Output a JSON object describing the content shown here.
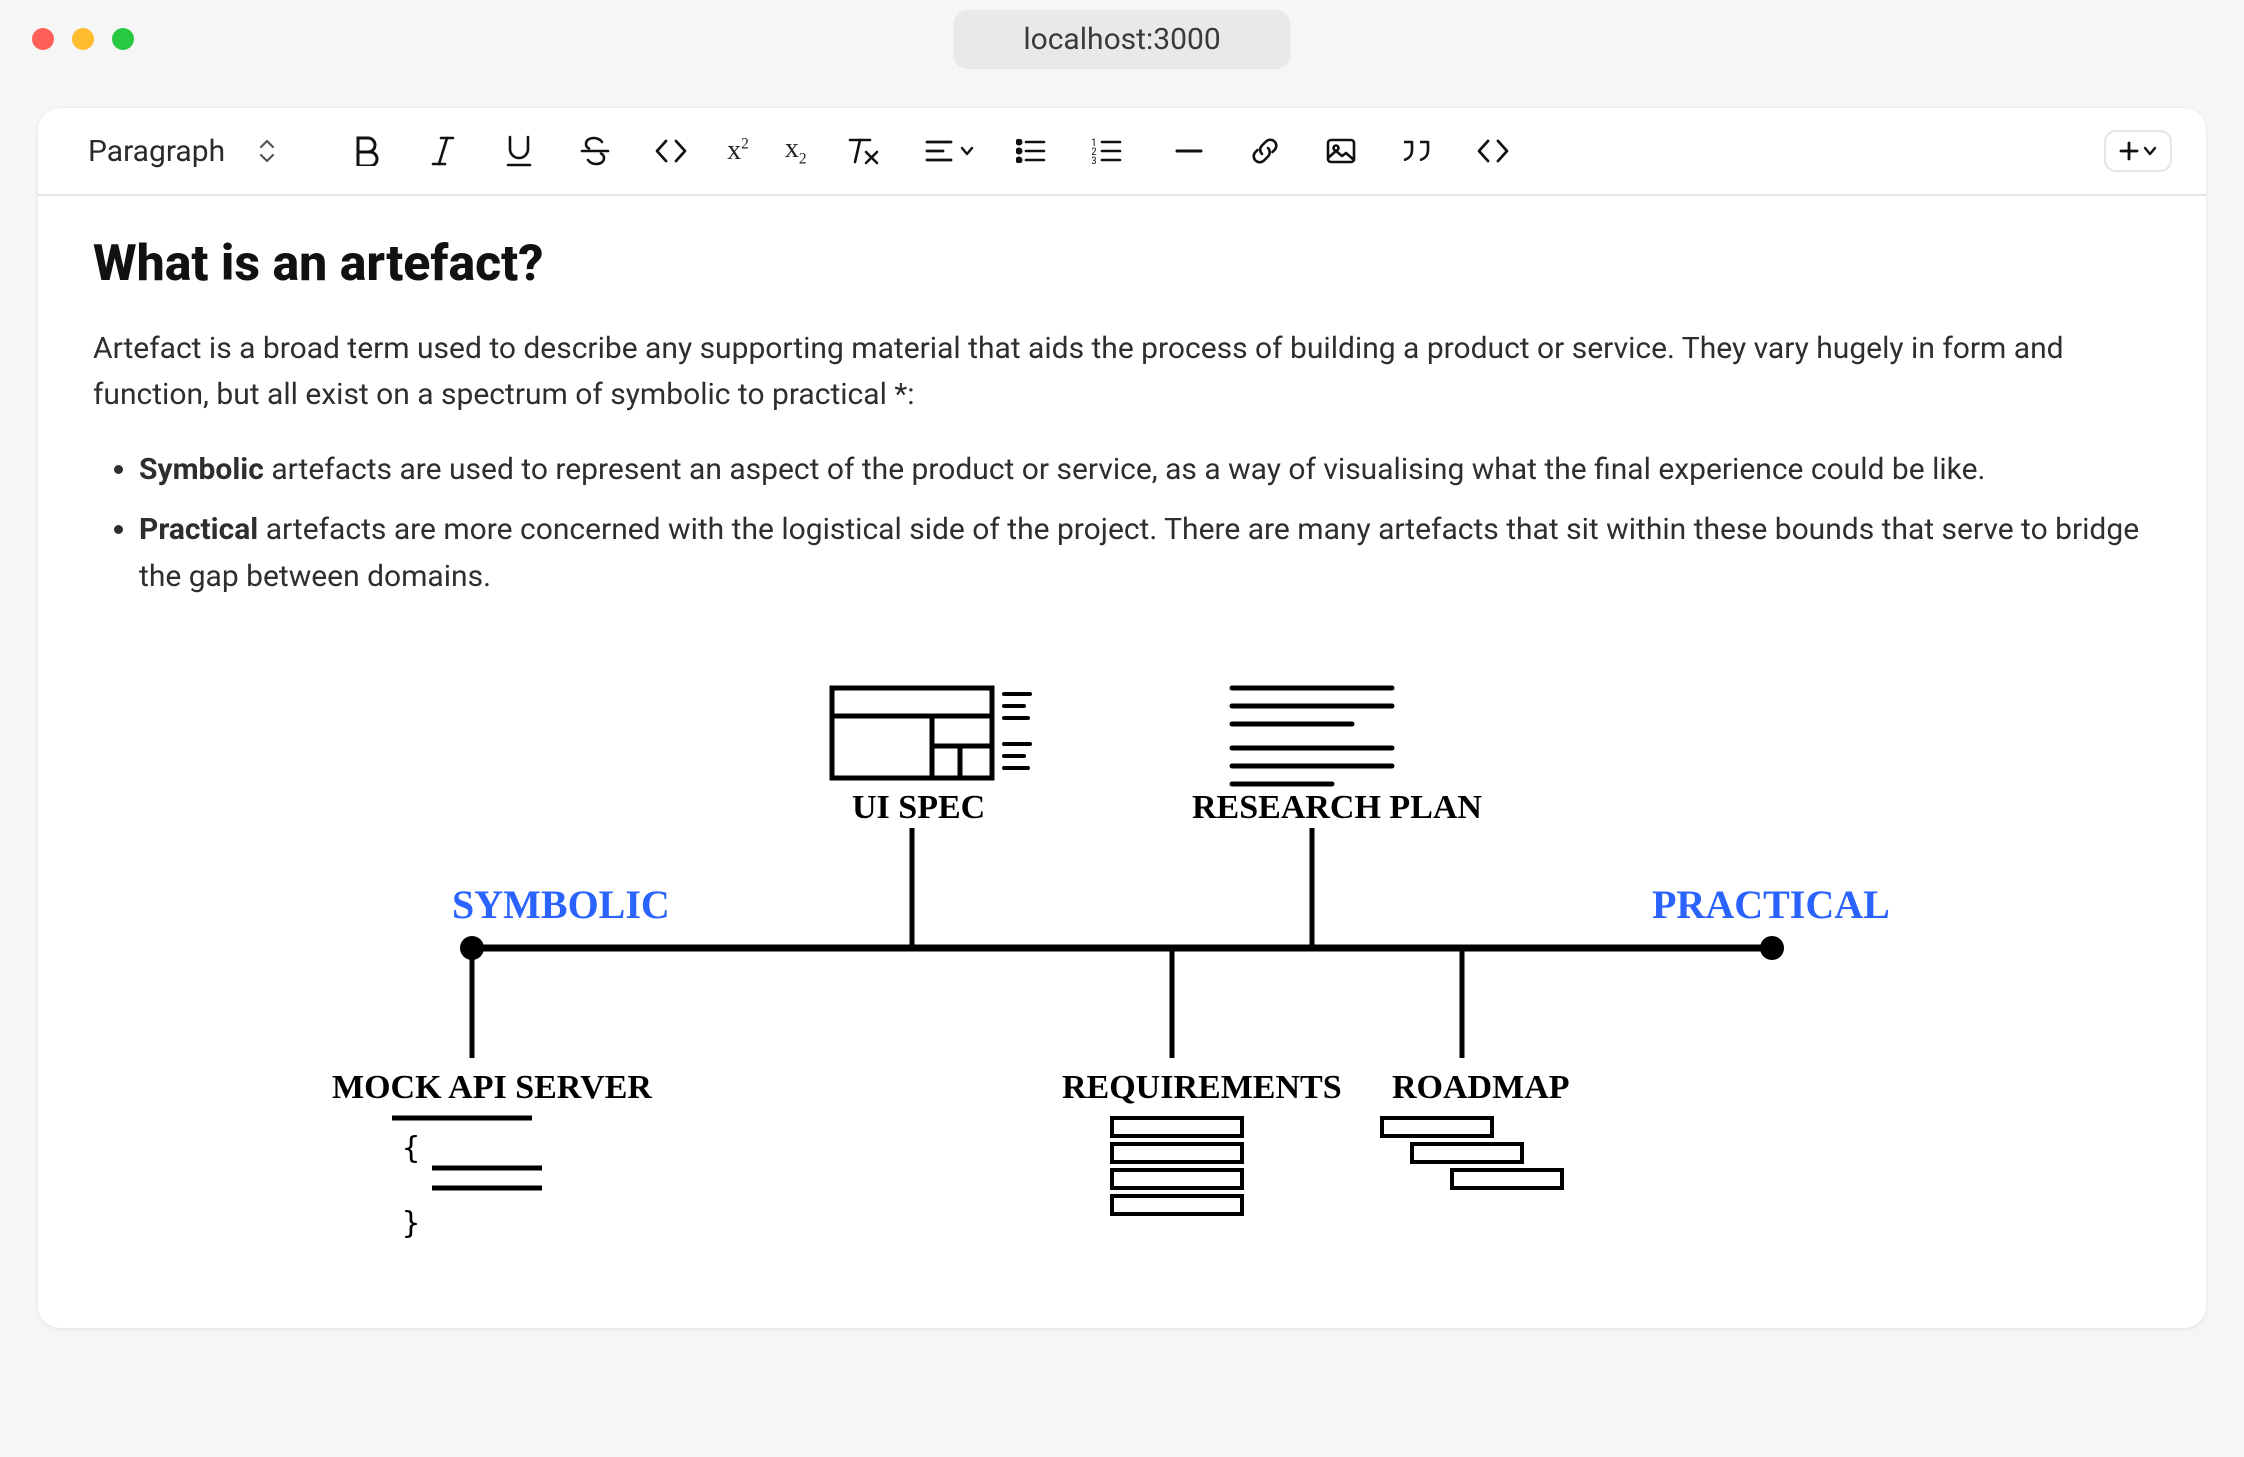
{
  "browser": {
    "url": "localhost:3000"
  },
  "toolbar": {
    "block_type": "Paragraph",
    "buttons": {
      "bold": "B",
      "italic": "I",
      "underline": "U",
      "strike": "S",
      "code_inline": "<>",
      "superscript": "x²",
      "subscript": "x₂",
      "clear_format": "Tx",
      "align": "≡",
      "bullet_list": "•",
      "ordered_list": "1.",
      "hr": "—",
      "link": "link",
      "image": "image",
      "blockquote": "quote",
      "code_block": "<>",
      "insert": "+"
    }
  },
  "document": {
    "heading": "What is an artefact?",
    "intro": "Artefact is a broad term used to describe any supporting material that aids the process of building a product or service. They vary hugely in form and function, but all exist on a spectrum of symbolic to practical *:",
    "list": [
      {
        "term": "Symbolic",
        "rest": " artefacts are used to represent an aspect of the product or service, as a way of visualising what the final experience could be like."
      },
      {
        "term": "Practical",
        "rest": " artefacts are more concerned with the logistical side of the project. There are many artefacts that sit within these bounds that serve to bridge the gap between domains."
      }
    ]
  },
  "diagram": {
    "left_label": "SYMBOLIC",
    "right_label": "PRACTICAL",
    "top_items": [
      "UI SPEC",
      "RESEARCH PLAN"
    ],
    "bottom_items": [
      "MOCK API SERVER",
      "REQUIREMENTS",
      "ROADMAP"
    ],
    "mock_api_brace_open": "{",
    "mock_api_brace_close": "}"
  }
}
